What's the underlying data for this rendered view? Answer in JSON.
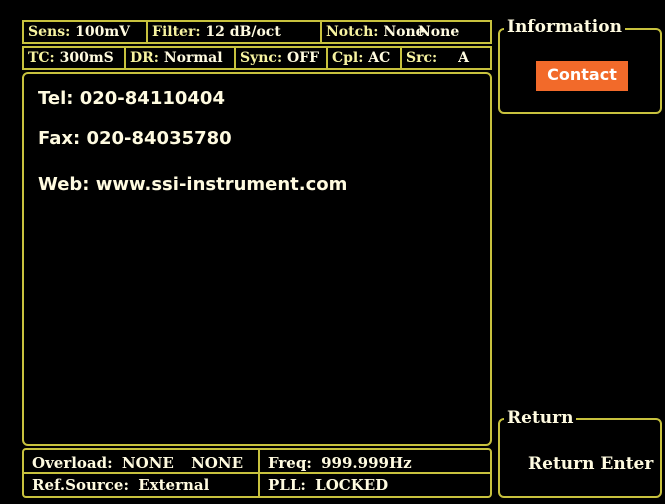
{
  "status_bar": {
    "row1": [
      {
        "key": "Sens:",
        "value": "100mV"
      },
      {
        "key": "Filter:",
        "value": "12 dB/oct"
      },
      {
        "key": "Notch:",
        "value": "None"
      },
      {
        "key": "",
        "value": "None"
      }
    ],
    "row2": [
      {
        "key": "TC:",
        "value": "300mS"
      },
      {
        "key": "DR:",
        "value": "Normal"
      },
      {
        "key": "Sync:",
        "value": "OFF"
      },
      {
        "key": "Cpl:",
        "value": "AC"
      },
      {
        "key": "Src:",
        "value": "A"
      }
    ]
  },
  "contact_info": {
    "tel": "Tel: 020-84110404",
    "fax": "Fax: 020-84035780",
    "web": "Web: www.ssi-instrument.com"
  },
  "footer": {
    "overload_label": "Overload:",
    "overload_value1": "NONE",
    "overload_value2": "NONE",
    "freq_label": "Freq:",
    "freq_value": "999.999Hz",
    "ref_source_label": "Ref.Source:",
    "ref_source_value": "External",
    "pll_label": "PLL:",
    "pll_value": "LOCKED"
  },
  "information_panel": {
    "title": "Information",
    "button_label": "Contact"
  },
  "return_panel": {
    "title": "Return",
    "button_label": "Return Enter"
  },
  "colors": {
    "border": "#c8c23e",
    "text": "#fffbe0",
    "accent_button": "#f26a2a",
    "background": "#000000"
  }
}
